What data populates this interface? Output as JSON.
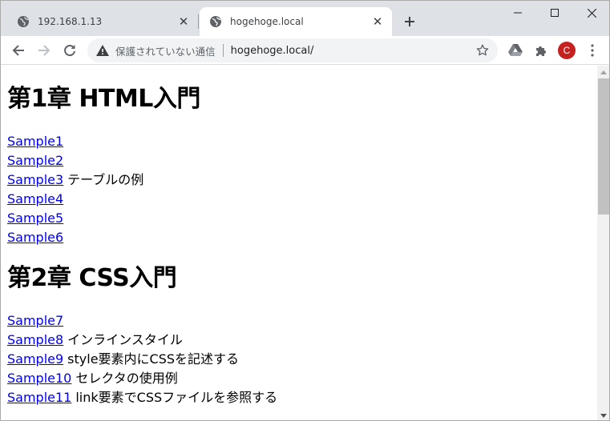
{
  "tabs": [
    {
      "title": "192.168.1.13",
      "favicon": "globe-icon",
      "active": false
    },
    {
      "title": "hogehoge.local",
      "favicon": "globe-icon",
      "active": true
    }
  ],
  "toolbar": {
    "security_text": "保護されていない通信",
    "url": "hogehoge.local/",
    "profile_initial": "C",
    "profile_color": "#c5221f"
  },
  "page": {
    "chapter1": {
      "heading": "第1章 HTML入門",
      "items": [
        {
          "link": "Sample1",
          "note": ""
        },
        {
          "link": "Sample2",
          "note": ""
        },
        {
          "link": "Sample3",
          "note": "テーブルの例"
        },
        {
          "link": "Sample4",
          "note": ""
        },
        {
          "link": "Sample5",
          "note": ""
        },
        {
          "link": "Sample6",
          "note": ""
        }
      ]
    },
    "chapter2": {
      "heading": "第2章 CSS入門",
      "items": [
        {
          "link": "Sample7",
          "note": ""
        },
        {
          "link": "Sample8",
          "note": "インラインスタイル"
        },
        {
          "link": "Sample9",
          "note": "style要素内にCSSを記述する"
        },
        {
          "link": "Sample10",
          "note": "セレクタの使用例"
        },
        {
          "link": "Sample11",
          "note": "link要素でCSSファイルを参照する"
        }
      ]
    }
  },
  "colors": {
    "link": "#0000ee",
    "tabstrip": "#dee1e6",
    "omnibox": "#f1f3f4"
  }
}
